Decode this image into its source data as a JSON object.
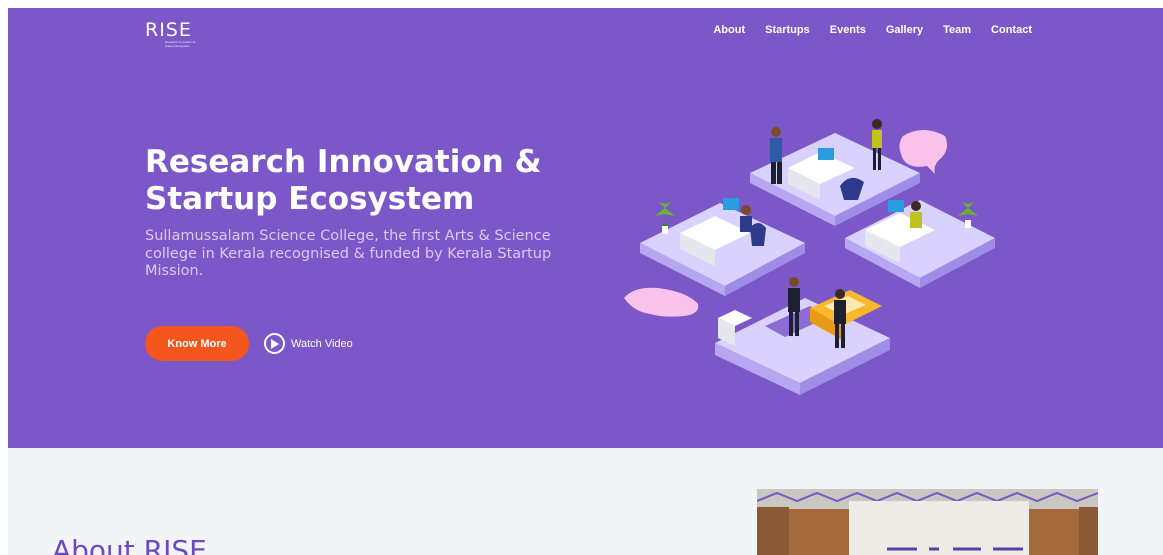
{
  "brand": {
    "logo_text": "RISE",
    "logo_tagline": "Research Innovation & Startup Ecosystem"
  },
  "nav": {
    "items": [
      "About",
      "Startups",
      "Events",
      "Gallery",
      "Team",
      "Contact"
    ]
  },
  "hero": {
    "title": "Research Innovation & Startup Ecosystem",
    "subtitle": "Sullamussalam Science College, the first Arts & Science college in Kerala recognised & funded by Kerala Startup Mission.",
    "primary_button": "Know More",
    "secondary_link": "Watch Video"
  },
  "about": {
    "title": "About RISE"
  },
  "colors": {
    "hero_bg": "#7b57c7",
    "accent": "#f5561e",
    "about_bg": "#f3f4f8",
    "about_title": "#6a4bc4"
  },
  "icons": {
    "play": "play-circle-icon"
  }
}
